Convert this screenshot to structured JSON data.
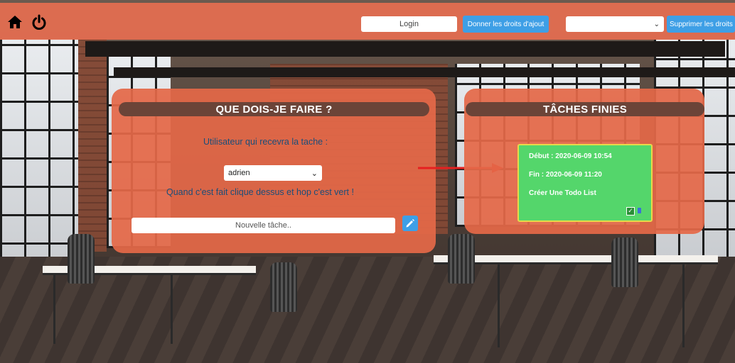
{
  "topbar": {
    "home_icon": "home-icon",
    "power_icon": "power-icon",
    "login_label": "Login",
    "grant_rights_label": "Donner les droits d'ajout",
    "user_select_value": "",
    "remove_rights_label": "Supprimer les droits"
  },
  "todo_panel": {
    "title": "QUE DOIS-JE FAIRE ?",
    "recipient_label": "Utilisateur qui recevra la tache :",
    "user_selected": "adrien",
    "hint": "Quand c'est fait clique dessus et hop c'est vert !",
    "new_task_placeholder": "Nouvelle tâche..",
    "edit_icon": "pencil-icon"
  },
  "done_panel": {
    "title": "TÂCHES FINIES",
    "tasks": [
      {
        "start": "Début : 2020-06-09 10:54",
        "end": "Fin : 2020-06-09 11:20",
        "name": "Créer Une Todo List"
      }
    ]
  },
  "colors": {
    "panel": "#e46848",
    "header": "#6b4438",
    "button": "#3e9fe6",
    "card": "#54d66b",
    "arrow": "#e62020"
  }
}
